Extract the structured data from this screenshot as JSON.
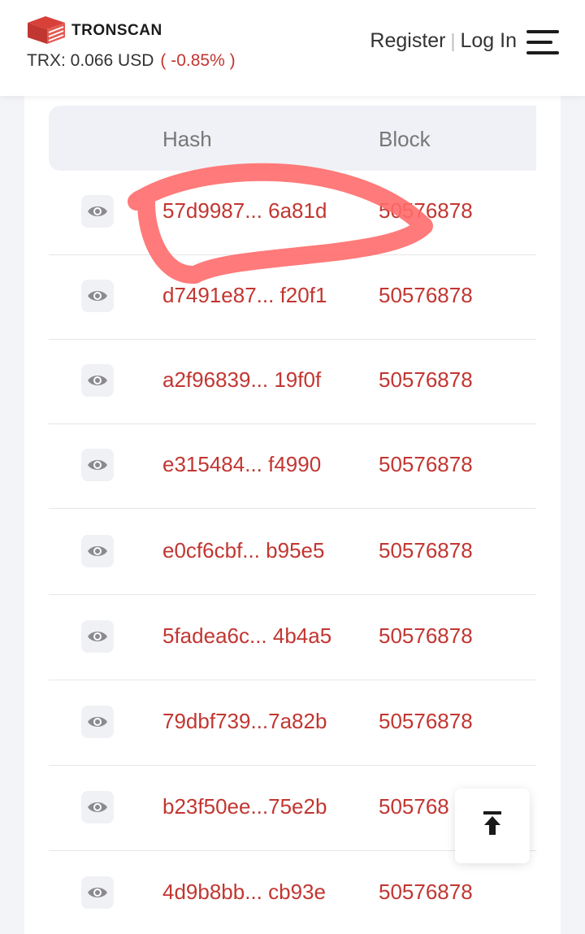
{
  "header": {
    "brand": "TRONSCAN",
    "price_label": "TRX: 0.066 USD",
    "price_change": "( -0.85% )",
    "register": "Register",
    "separator": "|",
    "login": "Log In",
    "icons": {
      "logo": "tronscan-logo",
      "menu": "hamburger-menu-icon"
    }
  },
  "table": {
    "columns": [
      "Hash",
      "Block"
    ],
    "rows": [
      {
        "hash": "57d9987... 6a81d",
        "block": "50576878"
      },
      {
        "hash": "d7491e87... f20f1",
        "block": "50576878"
      },
      {
        "hash": "a2f96839...  19f0f",
        "block": "50576878"
      },
      {
        "hash": "e315484...  f4990",
        "block": "50576878"
      },
      {
        "hash": "e0cf6cbf...  b95e5",
        "block": "50576878"
      },
      {
        "hash": "5fadea6c... 4b4a5",
        "block": "50576878"
      },
      {
        "hash": "79dbf739...7a82b",
        "block": "50576878"
      },
      {
        "hash": "b23f50ee...75e2b",
        "block": "505768"
      },
      {
        "hash": "4d9b8bb...  cb93e",
        "block": "50576878"
      }
    ],
    "row_icon": "eye-icon"
  },
  "colors": {
    "accent": "#c23631",
    "annotation": "#ff6b6b",
    "header_bg": "#ffffff",
    "page_bg": "#f3f4f8"
  },
  "back_to_top_icon": "arrow-up-to-line-icon"
}
